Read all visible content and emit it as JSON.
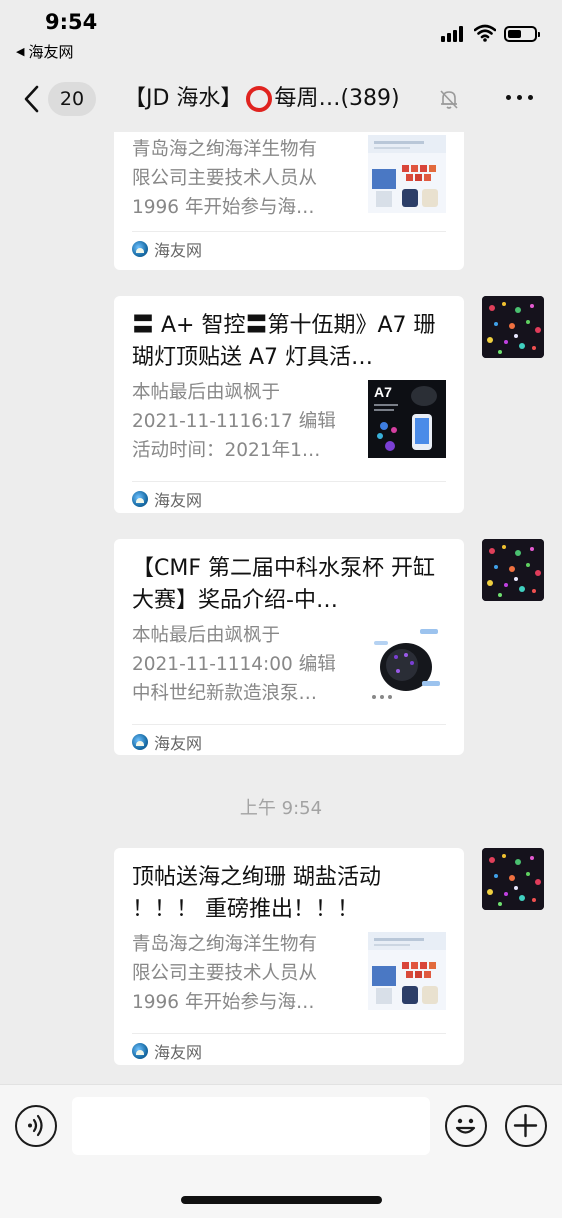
{
  "status_bar": {
    "time": "9:54",
    "back_app": "海友网"
  },
  "nav": {
    "unread_count": "20",
    "title_prefix": "【JD 海水】",
    "title_suffix": "每周…(389)",
    "mute_icon": "bell-muted-icon",
    "more_icon": "more-dots-icon"
  },
  "messages": [
    {
      "title": "",
      "desc": [
        "青岛海之绚海洋生物有",
        "限公司主要技术人员从",
        "1996 年开始参与海…"
      ],
      "source": "海友网",
      "thumb": "product-poster"
    },
    {
      "title": "〓 A+ 智控〓第十伍期》A7 珊 瑚灯顶贴送 A7 灯具活…",
      "desc": [
        "本帖最后由飒枫于",
        "2021-11-1116:17 编辑",
        "活动时间：2021年1…"
      ],
      "source": "海友网",
      "thumb": "a7-light-poster",
      "thumb_label": "A7"
    },
    {
      "title": "【CMF 第二届中科水泵杯 开缸大赛】奖品介绍-中…",
      "desc": [
        "本帖最后由飒枫于",
        "2021-11-1114:00 编辑",
        "中科世纪新款造浪泵…"
      ],
      "source": "海友网",
      "thumb": "wave-pump-image"
    },
    {
      "title": "顶帖送海之绚珊 瑚盐活动 ！！！ 重磅推出！！！",
      "desc": [
        "青岛海之绚海洋生物有",
        "限公司主要技术人员从",
        "1996 年开始参与海…"
      ],
      "source": "海友网",
      "thumb": "product-poster"
    }
  ],
  "timestamp": "上午 9:54",
  "input": {
    "value": "",
    "placeholder": ""
  },
  "colors": {
    "background": "#ededed",
    "card": "#ffffff",
    "secondary_text": "#888888",
    "ring_red": "#e0231f"
  }
}
